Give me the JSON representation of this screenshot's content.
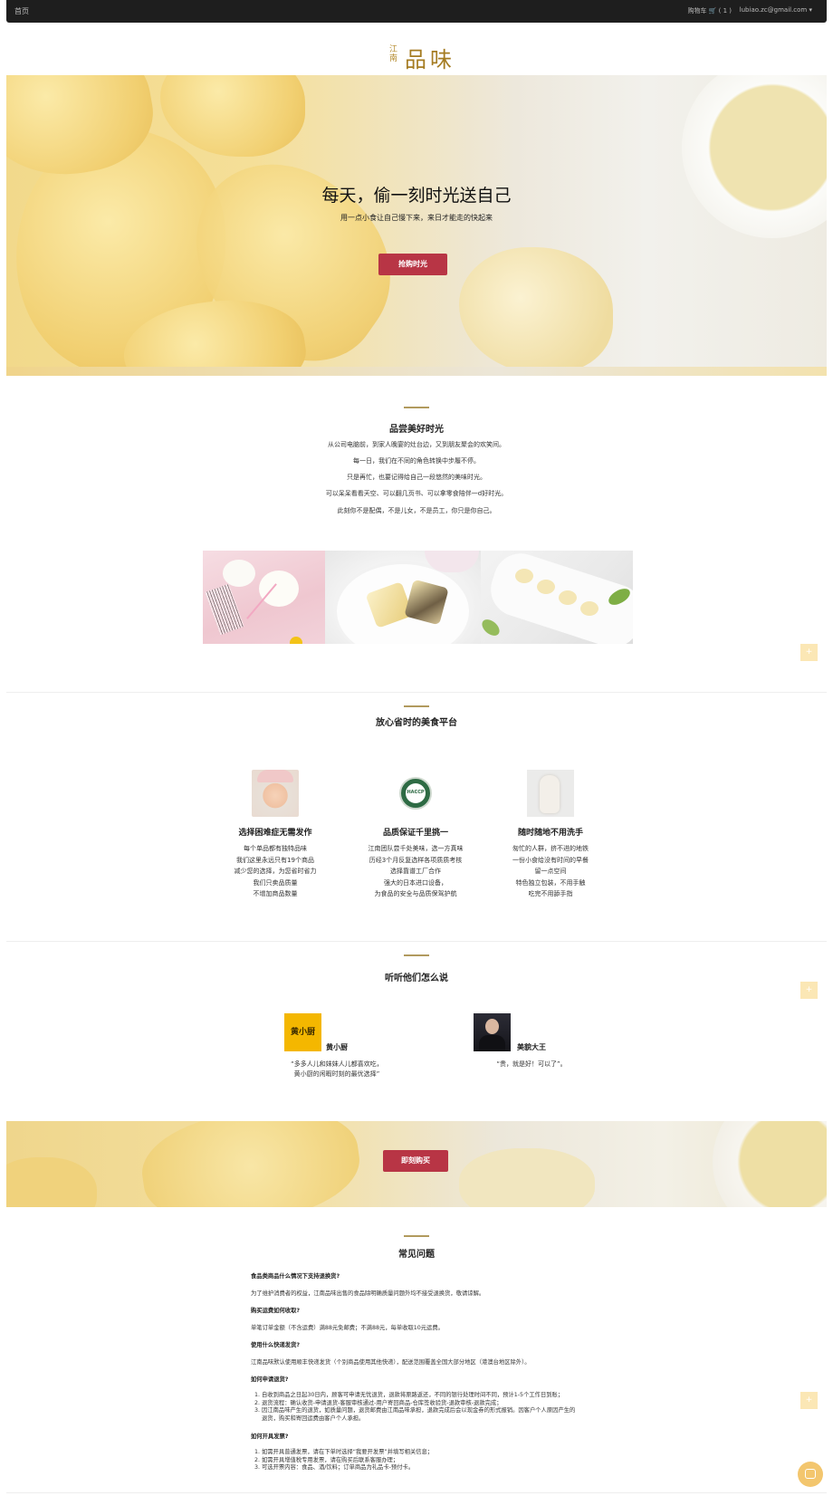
{
  "nav": {
    "home": "首页",
    "cart": "购物车 🛒 ( 1 )",
    "user": "lubiao.zc@gmail.com ▾"
  },
  "logo": {
    "small": "江南",
    "big": "品味"
  },
  "hero": {
    "title": "每天，偷一刻时光送自己",
    "subtitle": "用一点小食让自己慢下来，来日才能走的快起来",
    "button": "抢购时光"
  },
  "about": {
    "title": "品尝美好时光",
    "lines": [
      "从公司电脑前，到家人晚宴的灶台边，又到朋友聚会的欢笑间。",
      "每一日，我们在不同的角色转换中步履不停。",
      "只是再忙，也要记得给自己一段悠然的美味时光。",
      "可以呆呆看看天空、可以翻几页书、可以拿零食陪伴一d好时光。",
      "此刻你不是配偶，不是儿女，不是员工，你只是你自己。"
    ]
  },
  "platform": {
    "title": "放心省时的美食平台",
    "features": [
      {
        "title": "选择困难症无需发作",
        "lines": [
          "每个单品都有独特品味",
          "我们这里永远只有19个商品",
          "减少您的选择，为您省时省力",
          "我们只卖品质量",
          "不增加商品数量"
        ]
      },
      {
        "title": "品质保证千里挑一",
        "lines": [
          "江南团队尝千处美味，选一方真味",
          "历经3个月反复选样各项质质考核",
          "选择靠谱工厂合作",
          "强大的日本进口设备，",
          "为食品的安全与品质保驾护航"
        ]
      },
      {
        "title": "随时随地不用洗手",
        "lines": [
          "匆忙的人群，挤不进的地铁",
          "一份小食给没有时间的早餐",
          "留一点空间",
          "特色独立包装，不用手触",
          "吃完不用舔手指"
        ]
      }
    ],
    "haccp": "HACCP"
  },
  "testimonials": {
    "title": "听听他们怎么说",
    "items": [
      {
        "name": "黄小厨",
        "logo_text": "黄小厨",
        "quote": "“多多人儿和妹妹人儿都喜欢吃，黄小厨的闲暇时刻的最优选择”"
      },
      {
        "name": "美貌大王",
        "quote": "“贵，就是好！可以了”。"
      }
    ]
  },
  "banner": {
    "button": "即刻购买"
  },
  "faq": {
    "title": "常见问题",
    "q1": "食品类商品什么情况下支持退换货?",
    "a1": "为了维护消费者的权益，江南品味出售的食品除明确质量问题外均不接受退换货，敬请谅解。",
    "q2": "购买运费如何收取?",
    "a2": "单笔订单金额（不含运费）满88元免邮费；不满88元，每单收取10元运费。",
    "q3": "使用什么快递发货?",
    "a3": "江南品味默认使用顺丰快递发货（个别商品使用其他快递），配送范围覆盖全国大部分地区（港澳台地区除外）。",
    "q4": "如何申请退货?",
    "a4": [
      "自收到商品之日起30日内，顾客可申请无忧退货，退款将原路返还，不同的银行处理时间不同，预计1-5个工作日到账；",
      "退货流程：确认收货-申请退货-客服审核通过-用户寄回商品-仓库签收验货-退款审核-退款完成；",
      "因江南品味产生的退货，如质量问题，退货邮费由江南品味承担，退款完成后会以现金券的形式报销。因客户个人原因产生的退货，购买和寄回运费由客户个人承担。"
    ],
    "q5": "如何开具发票?",
    "a5": [
      "如需开具普通发票，请在下单时选择“我要开发票”并填写相关信息；",
      "如需开具增值税专用发票，请在购买后联系客服办理；",
      "可选开票内容：食品、酒/饮料；订单商品为礼品卡-预付卡。"
    ]
  },
  "float_icon": "+"
}
